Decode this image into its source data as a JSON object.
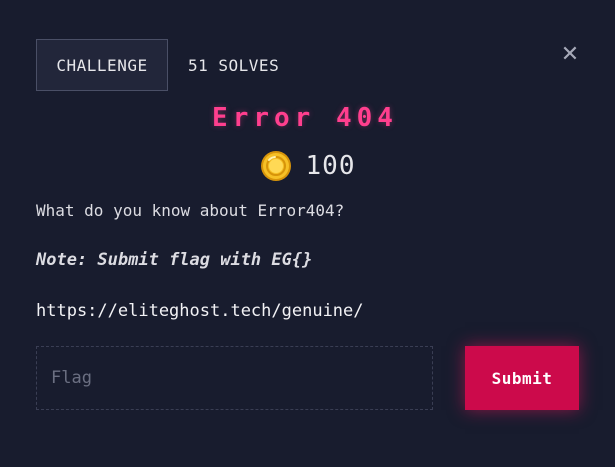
{
  "tabs": {
    "challenge_label": "CHALLENGE",
    "solves_label": "51 SOLVES"
  },
  "close_icon": "close-icon",
  "challenge": {
    "title": "Error 404",
    "points": "100",
    "points_icon": "coin-icon",
    "description": "What do you know about Error404?",
    "note": "Note: Submit flag with EG{}",
    "link": "https://eliteghost.tech/genuine/"
  },
  "form": {
    "flag_placeholder": "Flag",
    "flag_value": "",
    "submit_label": "Submit"
  },
  "colors": {
    "background": "#181c2e",
    "title": "#ff3f8e",
    "submit": "#cc0a4b",
    "coin": "#f2b21a"
  }
}
